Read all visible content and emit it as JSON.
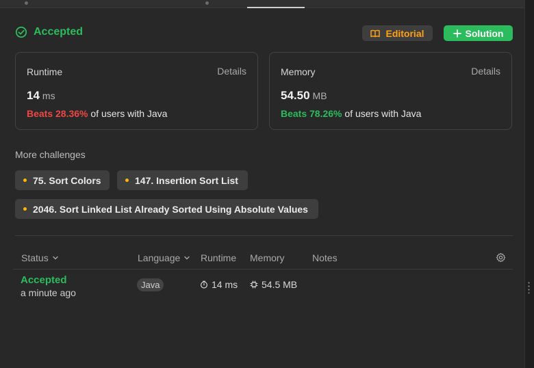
{
  "result": {
    "status": "Accepted",
    "editorial_label": "Editorial",
    "solution_label": "Solution"
  },
  "runtime_card": {
    "title": "Runtime",
    "details_label": "Details",
    "value": "14",
    "unit": "ms",
    "beats_label": "Beats 28.36%",
    "beats_suffix": "of users with Java"
  },
  "memory_card": {
    "title": "Memory",
    "details_label": "Details",
    "value": "54.50",
    "unit": "MB",
    "beats_label": "Beats 78.26%",
    "beats_suffix": "of users with Java"
  },
  "more_challenges": {
    "title": "More challenges",
    "items": [
      {
        "label": "75. Sort Colors"
      },
      {
        "label": "147. Insertion Sort List"
      },
      {
        "label": "2046. Sort Linked List Already Sorted Using Absolute Values"
      }
    ]
  },
  "submissions": {
    "columns": [
      "Status",
      "Language",
      "Runtime",
      "Memory",
      "Notes"
    ],
    "rows": [
      {
        "status": "Accepted",
        "time": "a minute ago",
        "language": "Java",
        "runtime": "14 ms",
        "memory": "54.5 MB"
      }
    ]
  },
  "colors": {
    "accent_green": "#2cbb5d",
    "accent_orange": "#ffa116",
    "beats_red": "#ef4743",
    "background": "#282828"
  }
}
